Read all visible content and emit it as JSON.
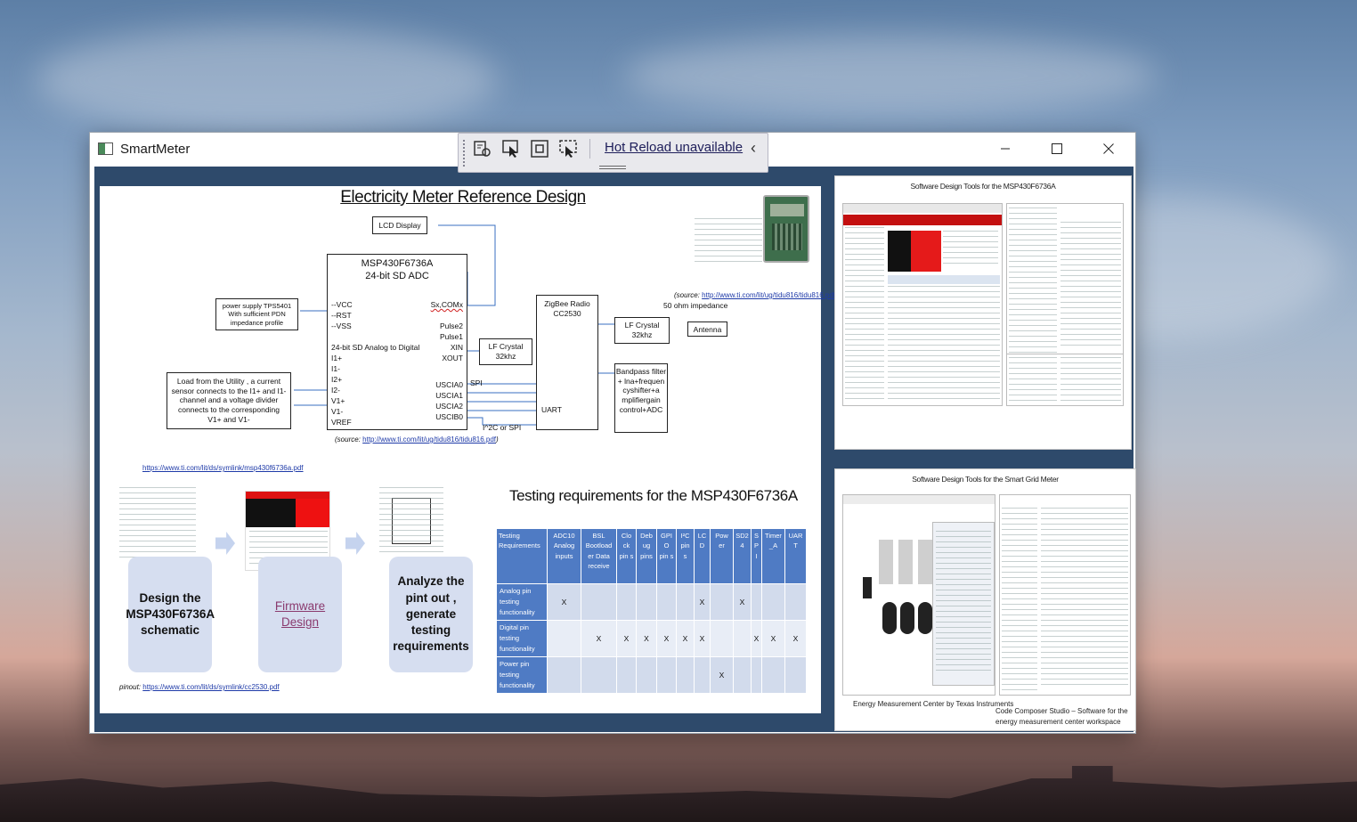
{
  "window": {
    "title": "SmartMeter"
  },
  "hot_reload": {
    "label": "Hot Reload unavailable"
  },
  "slide": {
    "title": "Electricity Meter Reference Design",
    "lcd": "LCD Display",
    "mcu_title_1": "MSP430F6736A",
    "mcu_title_2": "24-bit SD ADC",
    "mcu_pins_left": [
      "--VCC",
      "--RST",
      "--VSS",
      "24-bit SD Analog to Digital",
      "I1+",
      "I1-",
      "I2+",
      "I2-",
      "V1+",
      "V1-",
      "VREF"
    ],
    "mcu_pins_right": [
      "Sx,COMx",
      "Pulse2",
      "Pulse1",
      "XIN",
      "XOUT",
      "USCIA0",
      "USCIA1",
      "USCIA2",
      "USCIB0"
    ],
    "power_box": "power supply TPS5401 With sufficient PDN impedance profile",
    "load_box": "Load from the Utility , a current sensor connects to the I1+ and I1- channel and a voltage divider connects to the corresponding V1+ and V1-",
    "lf_crystal_1": "LF Crystal 32khz",
    "zigbee": "ZigBee Radio CC2530",
    "lf_crystal_2": "LF Crystal 32khz",
    "antenna": "Antenna",
    "impedance": "50 ohm impedance",
    "bandpass": "Bandpass filter + lna+frequen cyshifter+a mplifiergain control+ADC",
    "spi": "SPI",
    "uart": "UART",
    "i2c": "I^2C or SPI",
    "source_label": "(source:",
    "source_url": "http://www.ti.com/lit/ug/tidu816/tidu816.pdf",
    "source_close": ")",
    "datasheet_link": "https://www.ti.com/lit/ds/symlink/msp430f6736a.pdf",
    "pinout_label": "pinout:",
    "pinout_link": "https://www.ti.com/lit/ds/symlink/cc2530.pdf",
    "flow": [
      {
        "label": "Design the MSP430F6736A schematic"
      },
      {
        "label": "Firmware Design"
      },
      {
        "label": "Analyze the pint out , generate testing requirements"
      }
    ],
    "testing_title": "Testing requirements for the MSP430F6736A",
    "table": {
      "headers": [
        "Testing Requirements",
        "ADC10 Analog inputs",
        "BSL Bootload er Data receive",
        "Clo ck pin s",
        "Deb ug pins",
        "GPI O pin s",
        "I²C pin s",
        "LC D",
        "Pow er",
        "SD2 4",
        "S P I",
        "Timer _A",
        "UAR T"
      ],
      "rows": [
        {
          "label": "Analog pin testing functionality",
          "cells": [
            "X",
            "",
            "",
            "",
            "",
            "",
            "X",
            "",
            "X",
            "",
            "",
            ""
          ]
        },
        {
          "label": "Digital pin testing functionality",
          "cells": [
            "",
            "X",
            "X",
            "X",
            "X",
            "X",
            "X",
            "",
            "",
            "X",
            "X",
            "X"
          ]
        },
        {
          "label": "Power pin testing functionality",
          "cells": [
            "",
            "",
            "",
            "",
            "",
            "",
            "",
            "X",
            "",
            "",
            "",
            ""
          ]
        }
      ]
    }
  },
  "right_top": {
    "title": "Software Design Tools for the MSP430F6736A"
  },
  "right_bottom": {
    "title": "Software Design Tools for the Smart Grid Meter",
    "caption_left": "Energy Measurement Center by Texas Instruments",
    "caption_right": "Code Composer Studio – Software for the energy measurement center workspace"
  }
}
